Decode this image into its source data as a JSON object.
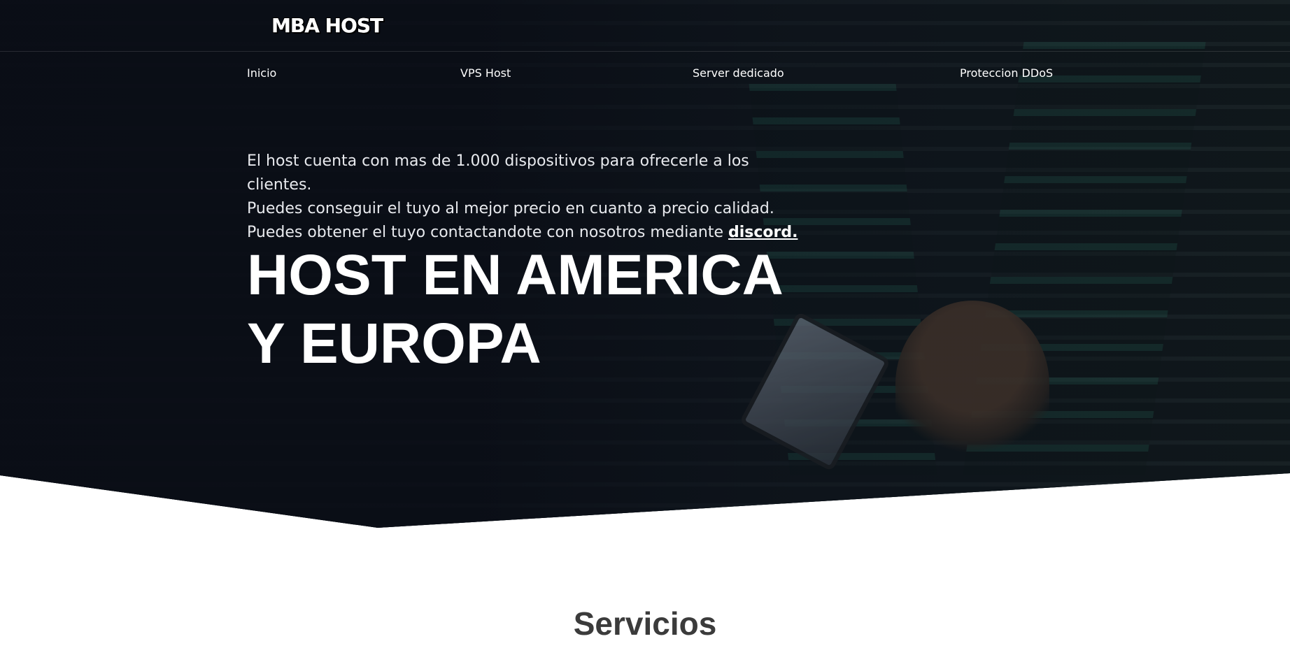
{
  "header": {
    "logo_text": "MBA HOST"
  },
  "nav": {
    "items": [
      {
        "label": "Inicio"
      },
      {
        "label": "VPS Host"
      },
      {
        "label": "Server dedicado"
      },
      {
        "label": "Proteccion DDoS"
      }
    ]
  },
  "hero": {
    "line1": "El host cuenta con mas de 1.000 dispositivos para ofrecerle a los clientes.",
    "line2": "Puedes conseguir el tuyo al mejor precio en cuanto a precio calidad.",
    "line3_prefix": "Puedes obtener el tuyo contactandote con nosotros mediante ",
    "line3_link": "discord.",
    "headline_line1": "HOST EN AMERICA",
    "headline_line2": "Y EUROPA"
  },
  "section": {
    "title": "Servicios"
  },
  "colors": {
    "hero_bg": "#0a0d16",
    "text_light": "#ffffff",
    "section_title": "#3b3b3b"
  }
}
